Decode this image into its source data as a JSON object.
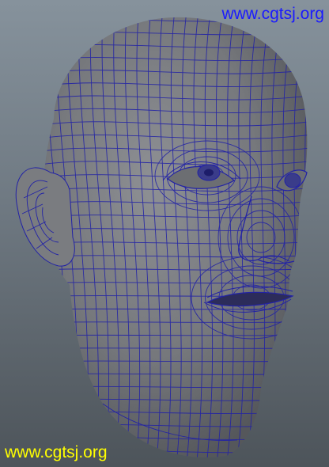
{
  "viewport": {
    "subject": "3D head model wireframe on shaded surface",
    "background_top": "#86929c",
    "background_bottom": "#4d545a",
    "mesh_color": "#2222a6",
    "surface_color": "#7e8084"
  },
  "watermarks": {
    "top": {
      "text": "www.cgtsj.org",
      "color": "#1a1aff"
    },
    "bottom": {
      "text": "www.cgtsj.org",
      "color": "#ffff00"
    }
  }
}
